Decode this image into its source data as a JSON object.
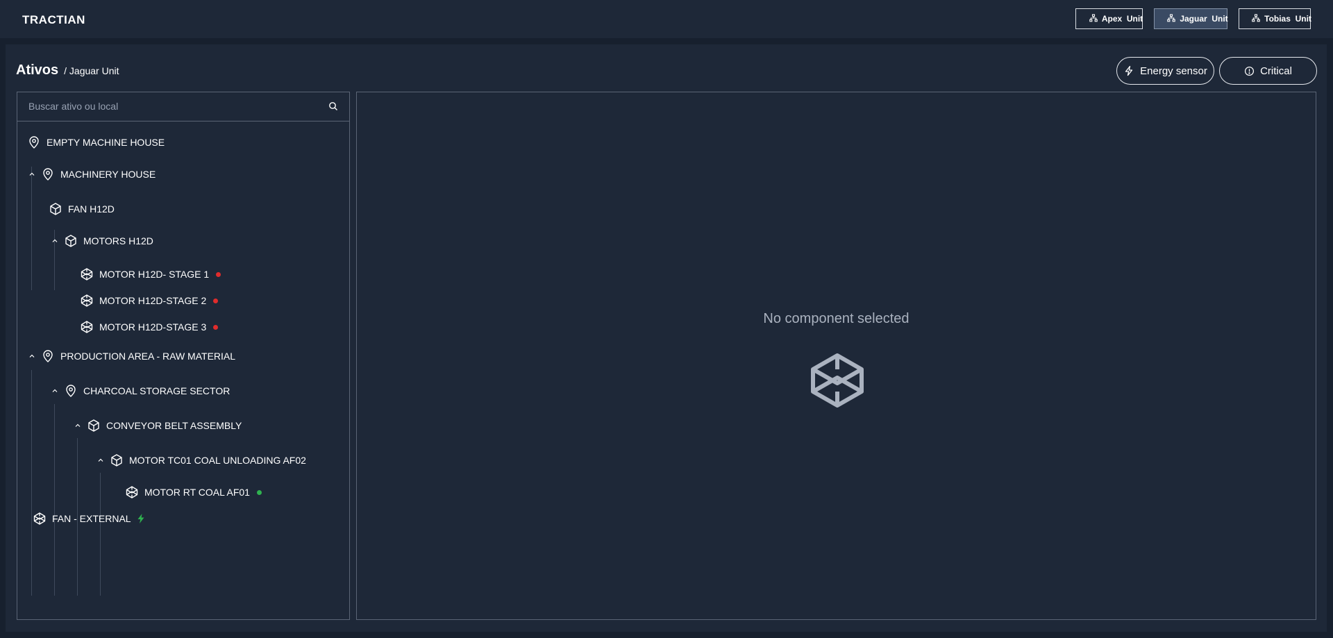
{
  "header": {
    "logo": "TRACTIAN",
    "units": [
      {
        "label": "Apex  Unit",
        "icon": "sitemap-icon",
        "active": false
      },
      {
        "label": "Jaguar  Unit",
        "icon": "sitemap-icon",
        "active": true
      },
      {
        "label": "Tobias  Unit",
        "icon": "sitemap-icon",
        "active": false
      }
    ]
  },
  "page": {
    "title": "Ativos",
    "breadcrumb": "/ Jaguar Unit",
    "filters": {
      "energy_label": "Energy sensor",
      "critical_label": "Critical"
    }
  },
  "tree": {
    "search_placeholder": "Buscar ativo ou local",
    "items": [
      {
        "label": "EMPTY MACHINE HOUSE",
        "type": "location",
        "expanded": null,
        "status": null
      },
      {
        "label": "MACHINERY HOUSE",
        "type": "location",
        "expanded": true,
        "status": null
      },
      {
        "label": "FAN H12D",
        "type": "asset",
        "expanded": null,
        "status": null
      },
      {
        "label": "MOTORS H12D",
        "type": "asset",
        "expanded": true,
        "status": null
      },
      {
        "label": "MOTOR H12D- STAGE 1",
        "type": "component",
        "expanded": null,
        "status": "alert"
      },
      {
        "label": "MOTOR H12D-STAGE 2",
        "type": "component",
        "expanded": null,
        "status": "alert"
      },
      {
        "label": "MOTOR H12D-STAGE 3",
        "type": "component",
        "expanded": null,
        "status": "alert"
      },
      {
        "label": "PRODUCTION AREA - RAW MATERIAL",
        "type": "location",
        "expanded": true,
        "status": null
      },
      {
        "label": "CHARCOAL STORAGE SECTOR",
        "type": "location",
        "expanded": true,
        "status": null
      },
      {
        "label": "CONVEYOR BELT ASSEMBLY",
        "type": "asset",
        "expanded": true,
        "status": null
      },
      {
        "label": "MOTOR TC01 COAL UNLOADING AF02",
        "type": "asset",
        "expanded": true,
        "status": null
      },
      {
        "label": "MOTOR RT COAL AF01",
        "type": "component",
        "expanded": null,
        "status": "operating"
      },
      {
        "label": "FAN - EXTERNAL",
        "type": "component",
        "expanded": null,
        "status": "energy"
      }
    ]
  },
  "detail": {
    "empty_message": "No component selected",
    "empty_icon": "component-icon"
  },
  "colors": {
    "alert": "#e02c2c",
    "operating": "#2fb24f",
    "energy": "#2fb24f",
    "background": "#17202e",
    "panel": "#1e2838"
  }
}
